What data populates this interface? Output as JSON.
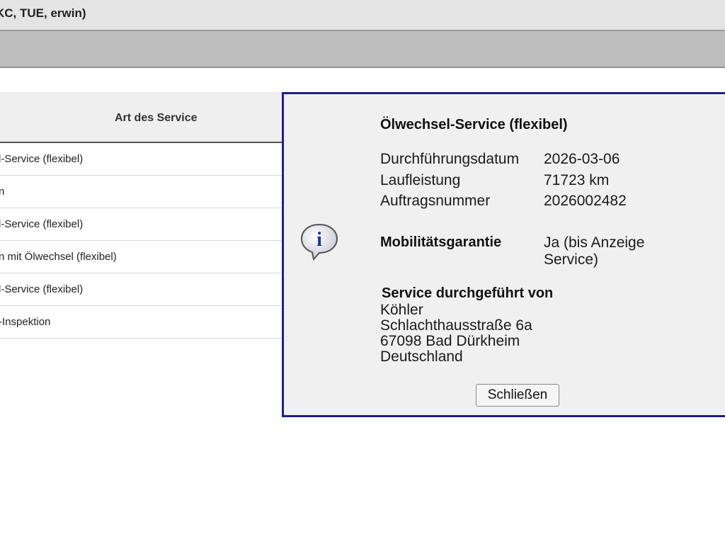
{
  "window": {
    "title": "KC, TUE, erwin)"
  },
  "table": {
    "header": "Art des Service",
    "rows": [
      "l-Service (flexibel)",
      "n",
      "l-Service (flexibel)",
      "n mit Ölwechsel (flexibel)",
      "l-Service (flexibel)",
      "-Inspektion"
    ]
  },
  "dialog": {
    "icon": "info-icon",
    "accent_color": "#1f1f8f",
    "title": "Ölwechsel-Service (flexibel)",
    "details": [
      {
        "label": "Durchführungsdatum",
        "value": "2026-03-06"
      },
      {
        "label": "Laufleistung",
        "value": "71723 km"
      },
      {
        "label": "Auftragsnummer",
        "value": "2026002482"
      }
    ],
    "mobility": {
      "label": "Mobilitätsgarantie",
      "value": "Ja (bis Anzeige Service)"
    },
    "provider": {
      "title": "Service durchgeführt von",
      "lines": [
        "Köhler",
        "Schlachthausstraße 6a",
        "67098 Bad Dürkheim",
        "Deutschland"
      ]
    },
    "close_label": "Schließen"
  }
}
